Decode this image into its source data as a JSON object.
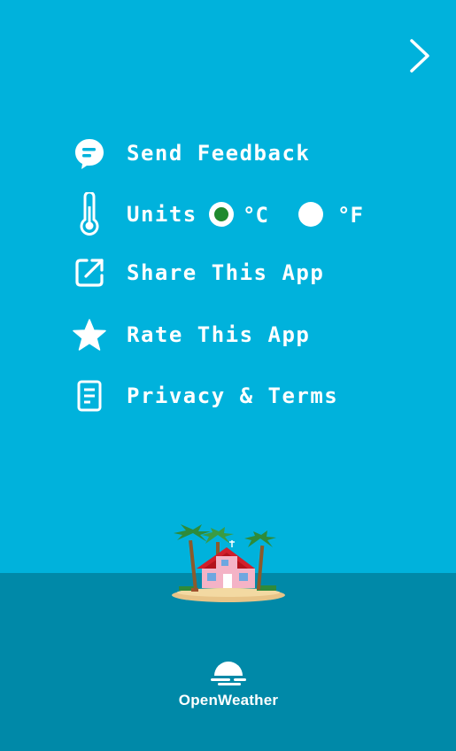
{
  "menu": {
    "items": [
      {
        "label": "Send Feedback",
        "icon": "chat-bubble-icon"
      },
      {
        "label": "Units",
        "icon": "thermometer-icon"
      },
      {
        "label": "Share This App",
        "icon": "share-external-icon"
      },
      {
        "label": "Rate This App",
        "icon": "star-icon"
      },
      {
        "label": "Privacy & Terms",
        "icon": "document-icon"
      }
    ]
  },
  "units": {
    "options": [
      "°C",
      "°F"
    ],
    "selected": "°C"
  },
  "brand": {
    "name": "OpenWeather"
  },
  "colors": {
    "sky": "#00b2dc",
    "sea": "#0089a8",
    "radio_selected": "#1f8a2e",
    "text": "#ffffff"
  }
}
